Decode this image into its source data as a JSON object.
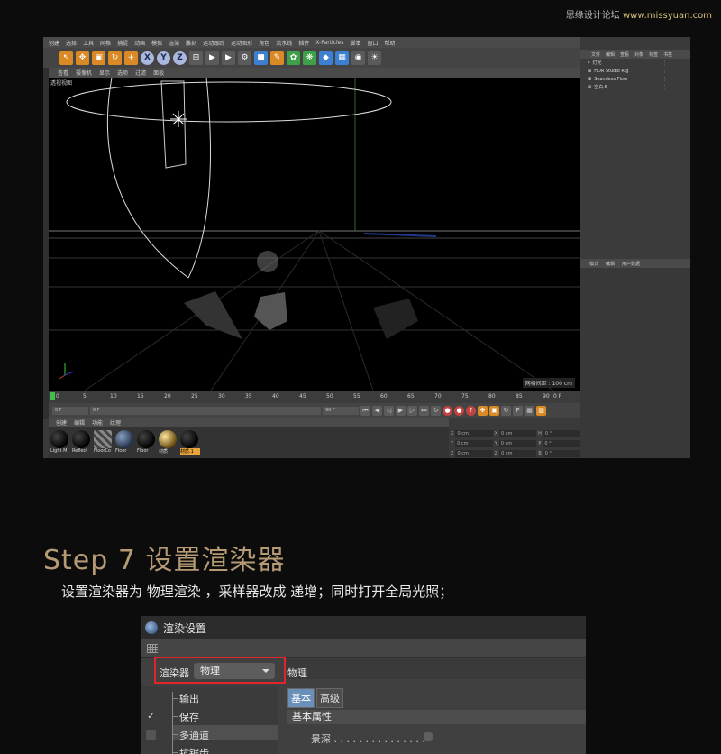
{
  "watermark": {
    "site_cn": "思缘设计论坛",
    "site_url": "www.missyuan.com"
  },
  "c4d": {
    "menu": [
      "创建",
      "选择",
      "工具",
      "网格",
      "捕捉",
      "动画",
      "模拟",
      "渲染",
      "雕刻",
      "运动跟踪",
      "运动图形",
      "角色",
      "流水线",
      "插件",
      "X-Particles",
      "脚本",
      "窗口",
      "帮助"
    ],
    "toolbar_xyz": [
      "X",
      "Y",
      "Z"
    ],
    "viewport_menu": [
      "查看",
      "摄像机",
      "显示",
      "选项",
      "过滤",
      "面板"
    ],
    "viewport_title": "透视视图",
    "viewport_scale": "网格间距 : 100 cm",
    "timeline_ticks": [
      "0",
      "5",
      "10",
      "15",
      "20",
      "25",
      "30",
      "35",
      "40",
      "45",
      "50",
      "55",
      "60",
      "65",
      "70",
      "75",
      "80",
      "85",
      "90"
    ],
    "timeline_end": "0 F",
    "playbar": {
      "start": "0 F",
      "current": "0 F",
      "end": "90 F",
      "max": "90 F"
    },
    "material_menu": [
      "创建",
      "编辑",
      "功能",
      "纹理"
    ],
    "materials": [
      {
        "label": "Light M",
        "style": "dark"
      },
      {
        "label": "Reflect",
        "style": "dark"
      },
      {
        "label": "FloorCo",
        "style": "stripe"
      },
      {
        "label": "Floor",
        "style": "blue"
      },
      {
        "label": "Floor",
        "style": "dark"
      },
      {
        "label": "材质",
        "style": "gold"
      },
      {
        "label": "材质.1",
        "style": "dark",
        "selected": true
      }
    ],
    "coords": [
      [
        "X",
        "0 cm",
        "X",
        "0 cm",
        "H",
        "0 °"
      ],
      [
        "Y",
        "0 cm",
        "Y",
        "0 cm",
        "P",
        "0 °"
      ],
      [
        "Z",
        "0 cm",
        "Z",
        "0 cm",
        "B",
        "0 °"
      ]
    ],
    "object_menu": [
      "文件",
      "编辑",
      "查看",
      "对象",
      "标签",
      "书签"
    ],
    "objects": [
      "灯光",
      "HDR Studio Rig",
      "Seamless Floor",
      "空白.5"
    ],
    "attr_menu": [
      "模式",
      "编辑",
      "用户数据"
    ]
  },
  "step": {
    "title": "Step 7   设置渲染器",
    "description": "设置渲染器为 物理渲染 ，采样器改成 递增；同时打开全局光照；"
  },
  "render_settings": {
    "window_title": "渲染设置",
    "renderer_label": "渲染器",
    "renderer_value": "物理",
    "right_label": "物理",
    "tree": [
      {
        "label": "输出",
        "checked": null
      },
      {
        "label": "保存",
        "checked": true
      },
      {
        "label": "多通道",
        "checked": false
      },
      {
        "label": "抗锯齿",
        "checked": null
      }
    ],
    "tabs": [
      "基本",
      "高级"
    ],
    "section": "基本属性",
    "property": "景深 . . . . . . . . . . . . . . ."
  }
}
